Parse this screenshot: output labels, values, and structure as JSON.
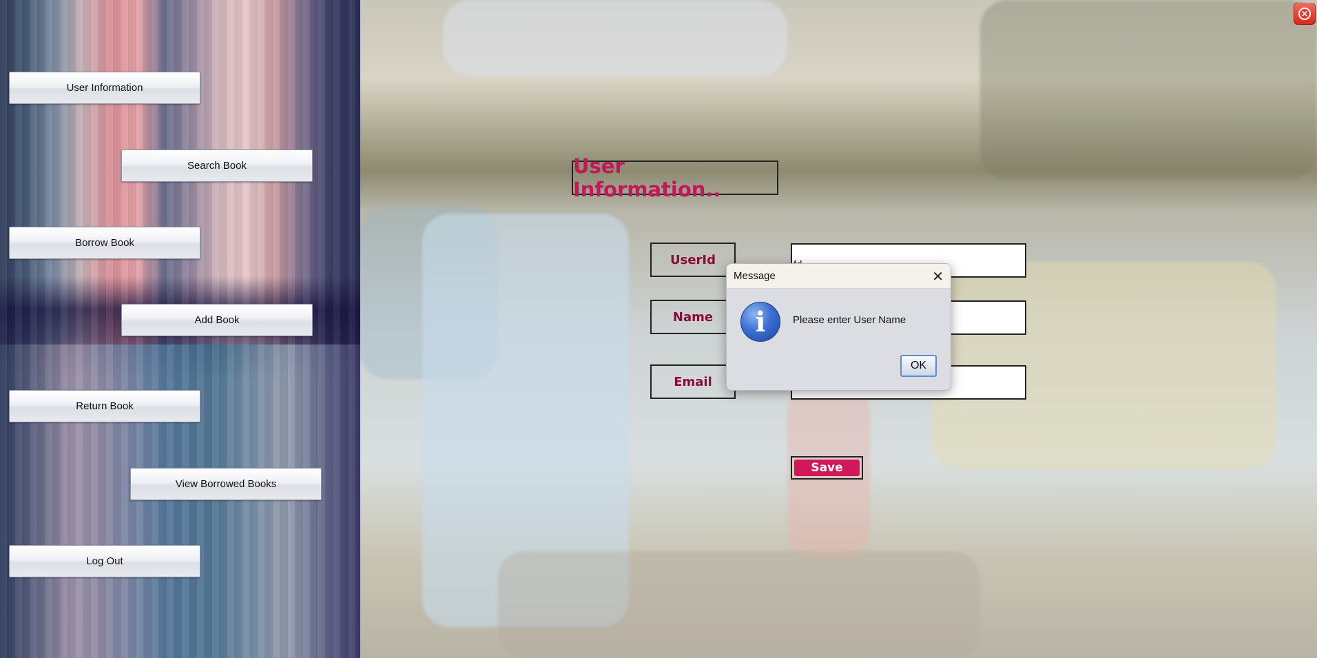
{
  "window": {
    "close_icon": "close-icon",
    "close_color": "#e0392a"
  },
  "sidebar": {
    "items": [
      {
        "label": "User Information"
      },
      {
        "label": "Search Book"
      },
      {
        "label": "Borrow Book"
      },
      {
        "label": "Add Book"
      },
      {
        "label": "Return Book"
      },
      {
        "label": "View Borrowed Books"
      },
      {
        "label": "Log Out"
      }
    ]
  },
  "form": {
    "title": "User Information..",
    "title_color": "#c2185b",
    "userid_label": "UserId",
    "userid_value": "fd",
    "name_label": "Name",
    "name_value": "",
    "email_label": "Email",
    "email_value": "",
    "save_label": "Save",
    "save_color": "#d0185a"
  },
  "dialog": {
    "title": "Message",
    "icon": "info-icon",
    "message": "Please enter User Name",
    "ok_label": "OK"
  }
}
